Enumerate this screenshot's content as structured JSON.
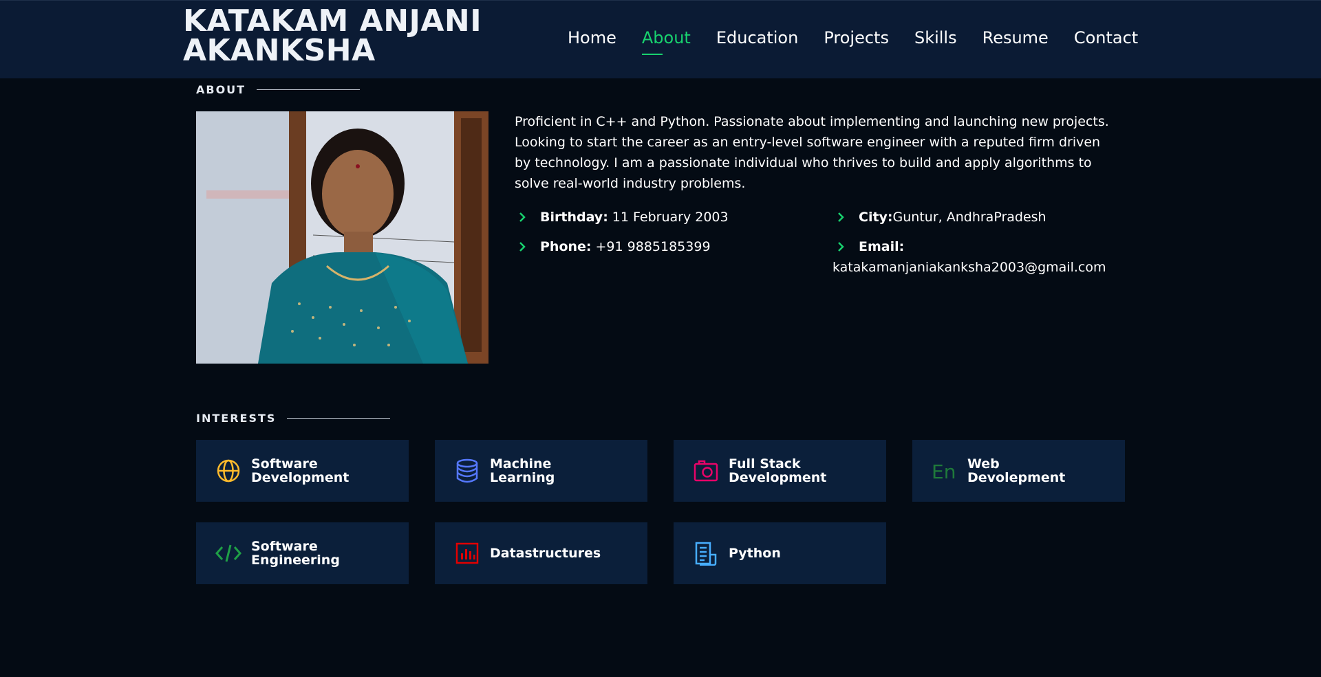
{
  "header": {
    "brand": "KATAKAM ANJANI AKANKSHA",
    "nav": [
      {
        "label": "Home",
        "active": false
      },
      {
        "label": "About",
        "active": true
      },
      {
        "label": "Education",
        "active": false
      },
      {
        "label": "Projects",
        "active": false
      },
      {
        "label": "Skills",
        "active": false
      },
      {
        "label": "Resume",
        "active": false
      },
      {
        "label": "Contact",
        "active": false
      }
    ]
  },
  "about": {
    "title": "ABOUT",
    "description": "Proficient in C++ and Python. Passionate about implementing and launching new projects. Looking to start the career as an entry-level software engineer with a reputed firm driven by technology. I am a passionate individual who thrives to build and apply algorithms to solve real-world industry problems.",
    "birthday_label": "Birthday:",
    "birthday_value": "11 February 2003",
    "phone_label": "Phone:",
    "phone_value": "+91 9885185399",
    "city_label": "City:",
    "city_value": "Guntur, AndhraPradesh",
    "email_label": "Email:",
    "email_value": "katakamanjaniakanksha2003@gmail.com"
  },
  "interests": {
    "title": "INTERESTS",
    "items": [
      {
        "label": "Software Development",
        "icon": "globe-icon",
        "color": "#ffbb2c"
      },
      {
        "label": "Machine Learning",
        "icon": "database-icon",
        "color": "#5578ff"
      },
      {
        "label": "Full Stack Development",
        "icon": "camera-icon",
        "color": "#e80368"
      },
      {
        "label": "Web Devolepment",
        "icon": "translate-icon",
        "color": "#11dbcf"
      },
      {
        "label": "Software Engineering",
        "icon": "code-icon",
        "color": "#47aeff"
      },
      {
        "label": "Datastructures",
        "icon": "bar-chart-icon",
        "color": "#e20000"
      },
      {
        "label": "Python",
        "icon": "document-icon",
        "color": "#47aeff"
      }
    ]
  },
  "colors": {
    "accent": "#18d26e",
    "background": "#040b14",
    "header_bg": "#0b1b34",
    "card_bg": "#0b1f3a"
  }
}
